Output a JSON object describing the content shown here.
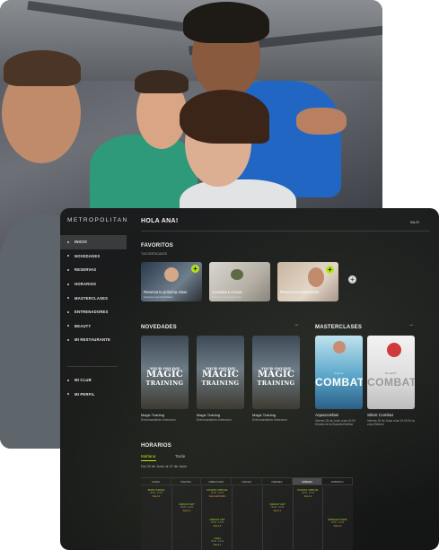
{
  "app": {
    "logo": "METROPOLITAN",
    "greeting": "HOLA ANA!",
    "logout": "SALIR"
  },
  "sidebar": {
    "items": [
      {
        "label": "INICIO"
      },
      {
        "label": "NOVEDADES"
      },
      {
        "label": "RESERVAS"
      },
      {
        "label": "HORARIOS"
      },
      {
        "label": "MASTERCLASES"
      },
      {
        "label": "ENTRENADORES"
      },
      {
        "label": "BEAUTY"
      },
      {
        "label": "MI RESTAURANTE"
      }
    ],
    "bottom_items": [
      {
        "label": "MI CLUB"
      },
      {
        "label": "MI PERFIL"
      }
    ]
  },
  "favoritos": {
    "title": "FAVORITOS",
    "subtitle": "TUS DESTACADOS",
    "items": [
      {
        "label": "Reserva tu próxima clase",
        "sub": "Sesiones de Actividades"
      },
      {
        "label": "Consulta tu mesa",
        "sub": "Entrenamiento Ejecución"
      },
      {
        "label": "Reserva tu tratamiento",
        "sub": "Beauty Center"
      }
    ],
    "add": "+"
  },
  "novedades": {
    "title": "NOVEDADES",
    "arrow": "→",
    "cards": [
      {
        "pre": "YOUR ONLINE",
        "big": "MAGIC",
        "small": "TRAINING",
        "name": "Magic Training",
        "category": "Entrenamiento Intensivo"
      },
      {
        "pre": "YOUR ONLINE",
        "big": "MAGIC",
        "small": "TRAINING",
        "name": "Magic Training",
        "category": "Entrenamiento Intensivo"
      },
      {
        "pre": "YOUR ONLINE",
        "big": "MAGIC",
        "small": "TRAINING",
        "name": "Magic Training",
        "category": "Entrenamiento Intensivo"
      }
    ]
  },
  "masterclases": {
    "title": "MASTERCLASES",
    "arrow": "→",
    "cards": [
      {
        "pre": "AQUA",
        "word": "COMBAT",
        "name": "Aquacombat",
        "desc": "Viernes 25 de Junio a las 10:00 Horario de la Escuela Exterior"
      },
      {
        "pre": "SILENT",
        "word": "COMBAT",
        "name": "Silent Combat",
        "desc": "Viernes 25 de Junio a las 10:00 En la zona Exterior"
      }
    ]
  },
  "horarios": {
    "title": "HORARIOS",
    "tabs": [
      "Mañana",
      "Tarde"
    ],
    "active_tab": "Mañana",
    "date_range": "Del 20 de Junio al 27 de Junio",
    "days": [
      "LUNES",
      "MARTES",
      "MIÉRCOLES",
      "JUEVES",
      "VIERNES",
      "SÁBADO",
      "DOMINGO"
    ],
    "active_day": "SÁBADO",
    "events": [
      {
        "name": "BODY DANCE",
        "time": "09:00 - 10:00",
        "room": "SALA 3"
      },
      {
        "name": "CICLING VIRTUAL",
        "time": "09:00 - 10:00",
        "room": "SALA ESTUDIO"
      },
      {
        "name": "CICLING VIRTUAL",
        "time": "09:00 - 10:00",
        "room": "SALA 3"
      },
      {
        "name": "CIRCUIT HIIT",
        "time": "09:00 - 10:00",
        "room": "SALA 1"
      },
      {
        "name": "CIRCUIT HIIT",
        "time": "09:00 - 10:00",
        "room": "SALA 1"
      },
      {
        "name": "CIRCUIT HIIT",
        "time": "09:00 - 10:00",
        "room": "SALA 3"
      },
      {
        "name": "ESPALDA SANA",
        "time": "09:00 - 10:00",
        "room": "SALA 3"
      },
      {
        "name": "YOGA",
        "time": "09:00 - 10:00",
        "room": "SALA 1"
      }
    ]
  },
  "colors": {
    "accent": "#b4e316",
    "panel": "#1b1c1d",
    "active_nav": "#3a3b3c"
  }
}
